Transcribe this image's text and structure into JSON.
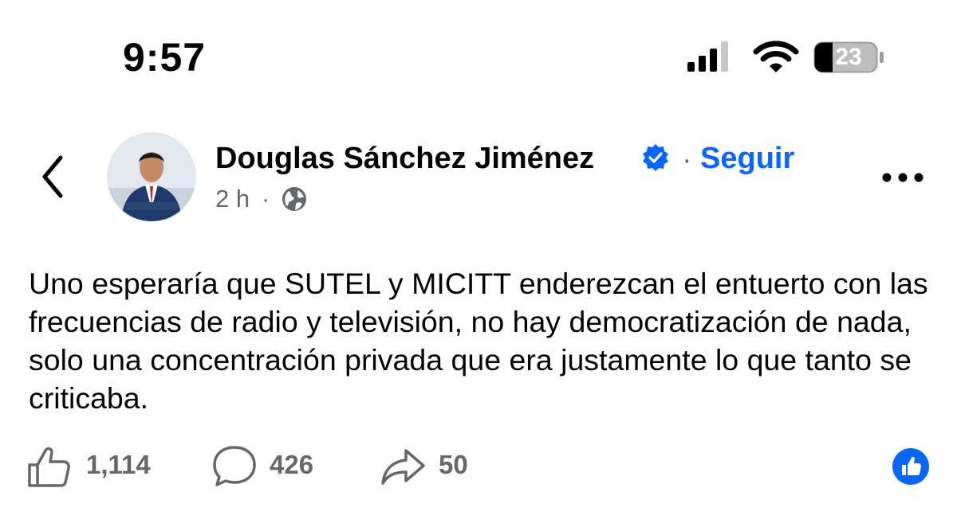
{
  "status_bar": {
    "time": "9:57",
    "battery_level": "23",
    "icons": [
      "cellular-signal-icon",
      "wifi-icon",
      "battery-icon"
    ]
  },
  "header": {
    "author_name": "Douglas Sánchez Jiménez",
    "separator": "·",
    "follow_label": "Seguir",
    "time_ago": "2 h",
    "meta_separator": "·",
    "icons": [
      "back-chevron-icon",
      "verified-badge-icon",
      "globe-icon",
      "more-options-icon"
    ]
  },
  "post": {
    "text": "Uno esperaría que SUTEL y MICITT enderezcan el entuerto con las frecuencias de radio y televisión, no hay democratización de nada, solo una concentración privada que era justamente lo que tanto se criticaba."
  },
  "actions": {
    "likes": "1,114",
    "comments": "426",
    "shares": "50",
    "icons": [
      "like-icon",
      "comment-icon",
      "share-icon",
      "like-reaction-icon"
    ]
  },
  "colors": {
    "accent": "#0866ff",
    "text": "#050505",
    "secondary": "#65676b"
  }
}
